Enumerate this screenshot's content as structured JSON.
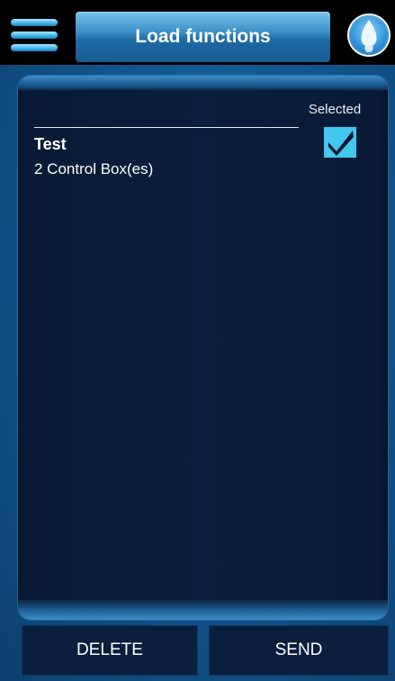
{
  "header": {
    "title": "Load functions",
    "menu_icon": "hamburger-menu-icon",
    "light_icon": "light-bulb-icon"
  },
  "list": {
    "selected_header": "Selected",
    "items": [
      {
        "title": "Test",
        "subtitle": "2 Control Box(es)",
        "selected": true
      }
    ]
  },
  "actions": {
    "delete_label": "DELETE",
    "send_label": "SEND"
  },
  "colors": {
    "accent": "#42c8ef",
    "panel_bg": "#0a1f3d",
    "app_bg": "#11578f"
  }
}
